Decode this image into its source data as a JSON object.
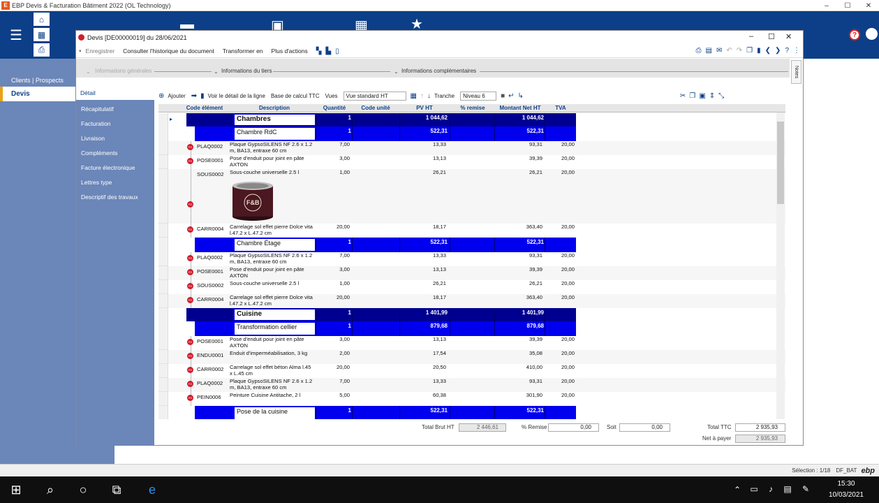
{
  "app": {
    "title": "EBP Devis & Facturation Bâtiment 2022 (OL Technology)",
    "logo": "E",
    "min": "–",
    "max": "☐",
    "close": "✕"
  },
  "leftnav": {
    "clients": "Clients | Prospects",
    "devis": "Devis"
  },
  "window": {
    "title": "Devis [DE00000019] du 28/06/2021",
    "min": "–",
    "max": "☐",
    "close": "✕"
  },
  "toolbar": {
    "save": "Enregistrer",
    "history": "Consulter l'historique du document",
    "transform": "Transformer en",
    "more": "Plus d'actions"
  },
  "info": {
    "general": "Informations générales",
    "tiers": "Informations du tiers",
    "complementary": "Informations complémentaires",
    "notes": "Notes"
  },
  "subnav": [
    "Détail",
    "Récapitulatif",
    "Facturation",
    "Livraison",
    "Compléments",
    "Facture électronique",
    "Lettres type",
    "Descriptif des travaux"
  ],
  "gridbar": {
    "add": "Ajouter",
    "detail": "Voir le détail de la ligne",
    "base": "Base de calcul TTC",
    "views": "Vues",
    "view_value": "Vue standard HT",
    "tranche": "Tranche",
    "level": "Niveau 6"
  },
  "columns": [
    "Code élément",
    "Description",
    "Quantité",
    "Code unité",
    "PV HT",
    "% remise",
    "Montant Net HT",
    "TVA"
  ],
  "rows": [
    {
      "type": "g1",
      "desc": "Chambres",
      "qty": "1",
      "pv": "1 044,62",
      "mnt": "1 044,62"
    },
    {
      "type": "g2",
      "desc": "Chambre RdC",
      "qty": "1",
      "pv": "522,31",
      "mnt": "522,31"
    },
    {
      "type": "i",
      "code": "PLAQ0002",
      "desc": "Plaque GypsoSILENS NF 2.6 x 1.2 m, BA13, entraxe 60 cm",
      "qty": "7,00",
      "pv": "13,33",
      "mnt": "93,31",
      "tva": "20,00"
    },
    {
      "type": "i",
      "code": "POSE0001",
      "desc": "Pose d'enduit pour joint en pâte AXTON",
      "qty": "3,00",
      "pv": "13,13",
      "mnt": "39,39",
      "tva": "20,00"
    },
    {
      "type": "i",
      "code": "SOUS0002",
      "desc": "Sous-couche universelle 2.5 l",
      "qty": "1,00",
      "pv": "26,21",
      "mnt": "26,21",
      "tva": "20,00",
      "img": true
    },
    {
      "type": "i",
      "code": "CARR0004",
      "desc": "Carrelage sol effet pierre Dolce vita l.47.2 x L.47.2 cm",
      "qty": "20,00",
      "pv": "18,17",
      "mnt": "363,40",
      "tva": "20,00"
    },
    {
      "type": "g2",
      "desc": "Chambre Étage",
      "qty": "1",
      "pv": "522,31",
      "mnt": "522,31"
    },
    {
      "type": "i",
      "code": "PLAQ0002",
      "desc": "Plaque GypsoSILENS NF 2.6 x 1.2 m, BA13, entraxe 60 cm",
      "qty": "7,00",
      "pv": "13,33",
      "mnt": "93,31",
      "tva": "20,00"
    },
    {
      "type": "i",
      "code": "POSE0001",
      "desc": "Pose d'enduit pour joint en pâte AXTON",
      "qty": "3,00",
      "pv": "13,13",
      "mnt": "39,39",
      "tva": "20,00"
    },
    {
      "type": "i",
      "code": "SOUS0002",
      "desc": "Sous-couche universelle 2.5 l",
      "qty": "1,00",
      "pv": "26,21",
      "mnt": "26,21",
      "tva": "20,00"
    },
    {
      "type": "i",
      "code": "CARR0004",
      "desc": "Carrelage sol effet pierre Dolce vita l.47.2 x L.47.2 cm",
      "qty": "20,00",
      "pv": "18,17",
      "mnt": "363,40",
      "tva": "20,00"
    },
    {
      "type": "g1",
      "desc": "Cuisine",
      "qty": "1",
      "pv": "1 401,99",
      "mnt": "1 401,99"
    },
    {
      "type": "g2",
      "desc": "Transformation cellier",
      "qty": "1",
      "pv": "879,68",
      "mnt": "879,68"
    },
    {
      "type": "i",
      "code": "POSE0001",
      "desc": "Pose d'enduit pour joint en pâte AXTON",
      "qty": "3,00",
      "pv": "13,13",
      "mnt": "39,39",
      "tva": "20,00"
    },
    {
      "type": "i",
      "code": "ENDU0001",
      "desc": "Enduit d'imperméabilisation, 3 kg",
      "qty": "2,00",
      "pv": "17,54",
      "mnt": "35,08",
      "tva": "20,00"
    },
    {
      "type": "i",
      "code": "CARR0002",
      "desc": "Carrelage sol effet béton Alma l.45 x L.45 cm",
      "qty": "20,00",
      "pv": "20,50",
      "mnt": "410,00",
      "tva": "20,00"
    },
    {
      "type": "i",
      "code": "PLAQ0002",
      "desc": "Plaque GypsoSILENS NF 2.6 x 1.2 m, BA13, entraxe 60 cm",
      "qty": "7,00",
      "pv": "13,33",
      "mnt": "93,31",
      "tva": "20,00"
    },
    {
      "type": "i",
      "code": "PEIN0006",
      "desc": "Peinture Cuisine Antitache, 2 l",
      "qty": "5,00",
      "pv": "60,38",
      "mnt": "301,90",
      "tva": "20,00"
    },
    {
      "type": "g2",
      "desc": "Pose de la cuisine",
      "qty": "1",
      "pv": "522,31",
      "mnt": "522,31"
    }
  ],
  "product_image_text": "F&B",
  "row_badge": "FO",
  "totals": {
    "brut_label": "Total Brut HT",
    "brut": "2 446,61",
    "remise_label": "% Remise",
    "remise": "0,00",
    "soit_label": "Soit",
    "soit": "0,00",
    "ttc_label": "Total TTC",
    "ttc": "2 935,93",
    "pay_label": "Net à payer",
    "pay": "2 935,93"
  },
  "status": {
    "selection": "Sélection : 1/18",
    "db": "DF_BAT",
    "brand": "ebp"
  },
  "clock": {
    "time": "15:30",
    "date": "10/03/2021"
  },
  "colors": {
    "ribbon": "#0c3f88",
    "nav": "#6b86b8",
    "group_band": "#0000ee",
    "accent": "#e8a317"
  }
}
